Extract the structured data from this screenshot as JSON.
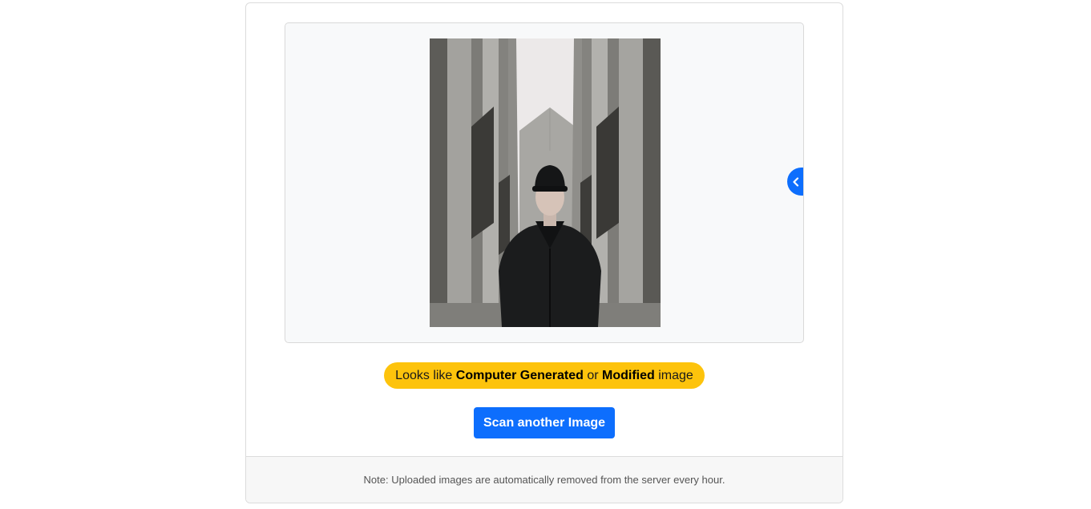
{
  "result": {
    "verdict_prefix": "Looks like ",
    "verdict_strong_1": "Computer Generated",
    "verdict_mid": " or ",
    "verdict_strong_2": "Modified",
    "verdict_suffix": " image",
    "verdict_color": "#fdc30c"
  },
  "actions": {
    "scan_label": "Scan another Image",
    "accent_color": "#0d6efd"
  },
  "preview": {
    "toggle_icon": "chevron-left-icon"
  },
  "footer": {
    "note": "Note: Uploaded images are automatically removed from the server every hour."
  }
}
